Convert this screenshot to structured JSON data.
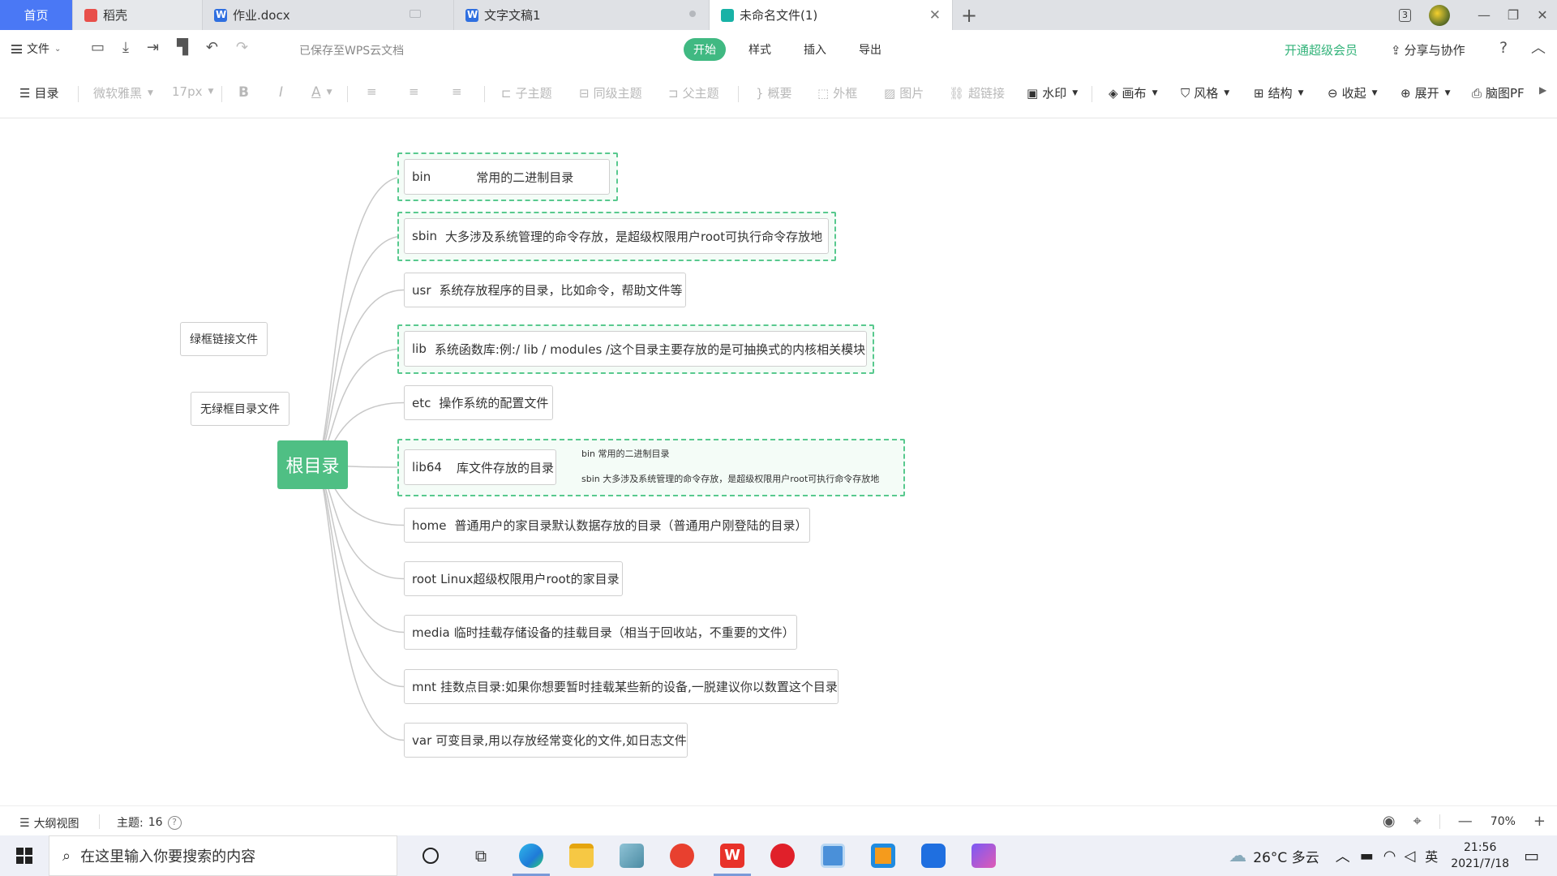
{
  "tabs": {
    "home": "首页",
    "daoke": "稻壳",
    "doc": "作业.docx",
    "text": "文字文稿1",
    "active": "未命名文件(1)"
  },
  "window": {
    "workspace_badge": "3"
  },
  "menubar": {
    "file_label": "文件",
    "save_status": "已保存至WPS云文档",
    "tabs": [
      "开始",
      "样式",
      "插入",
      "导出"
    ],
    "vip": "开通超级会员",
    "share": "分享与协作"
  },
  "toolbar": {
    "outline": "目录",
    "font_family": "微软雅黑",
    "font_size": "17px",
    "bold": "B",
    "italic": "I",
    "font_color": "A",
    "child_topic": "子主题",
    "sibling_topic": "同级主题",
    "parent_topic": "父主题",
    "summary": "概要",
    "outer_frame": "外框",
    "image": "图片",
    "hyperlink": "超链接",
    "watermark": "水印",
    "canvas": "画布",
    "style": "风格",
    "structure": "结构",
    "collapse": "收起",
    "expand": "展开",
    "mindmap_pdf": "脑图PF"
  },
  "mindmap": {
    "root": "根目录",
    "float_nodes": {
      "green_frame_link": "绿框链接文件",
      "no_frame_dir": "无绿框目录文件"
    },
    "nodes": [
      {
        "name": "bin",
        "desc": "常用的二进制目录"
      },
      {
        "name": "sbin",
        "desc": "大多涉及系统管理的命令存放，是超级权限用户root可执行命令存放地"
      },
      {
        "name": "usr",
        "desc": "系统存放程序的目录，比如命令，帮助文件等"
      },
      {
        "name": "lib",
        "desc": "系统函数库:例:/ lib / modules /这个目录主要存放的是可抽换式的内核相关模块"
      },
      {
        "name": "etc",
        "desc": "操作系统的配置文件"
      },
      {
        "name": "lib64",
        "desc": "库文件存放的目录"
      },
      {
        "name": "home",
        "desc": "普通用户的家目录默认数据存放的目录（普通用户刚登陆的目录）"
      },
      {
        "name": "root",
        "desc": "Linux超级权限用户root的家目录"
      },
      {
        "name": "media",
        "desc": "临时挂载存储设备的挂载目录（相当于回收站，不重要的文件）"
      },
      {
        "name": "mnt",
        "desc": "挂数点目录:如果你想要暂时挂载某些新的设备,一脱建议你以数置这个目录"
      },
      {
        "name": "var",
        "desc": "可变目录,用以存放经常变化的文件,如日志文件"
      }
    ],
    "lib64_children": [
      "bin 常用的二进制目录",
      "sbin  大多涉及系统管理的命令存放，是超级权限用户root可执行命令存放地"
    ]
  },
  "statusbar": {
    "outline_view": "大纲视图",
    "topic_label": "主题:",
    "topic_count": "16",
    "zoom": "70%"
  },
  "taskbar": {
    "search_placeholder": "在这里输入你要搜索的内容",
    "weather": "26°C 多云",
    "ime": "英",
    "time": "21:56",
    "date": "2021/7/18"
  },
  "colors": {
    "accent_green": "#40b982",
    "root_green": "#4fbf84",
    "frame_green": "#58c98e",
    "home_tab_blue": "#4a78f5"
  }
}
